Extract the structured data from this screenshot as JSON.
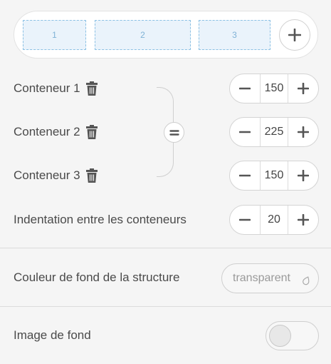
{
  "preview": {
    "cells": [
      "1",
      "2",
      "3"
    ]
  },
  "containers": [
    {
      "label": "Conteneur 1",
      "value": "150"
    },
    {
      "label": "Conteneur 2",
      "value": "225"
    },
    {
      "label": "Conteneur 3",
      "value": "150"
    }
  ],
  "indentation": {
    "label": "Indentation entre les conteneurs",
    "value": "20"
  },
  "background_color": {
    "label": "Couleur de fond de la structure",
    "value": "transparent"
  },
  "background_image": {
    "label": "Image de fond",
    "enabled": false
  },
  "colors": {
    "cell_fill": "#eaf3fb",
    "cell_border": "#8cc1e4",
    "text": "#4a4a4a",
    "icon": "#555555"
  },
  "icons": {
    "add": "plus-icon",
    "delete": "trash-icon",
    "equalize": "equal-icon",
    "decrement": "minus-icon",
    "increment": "plus-icon",
    "color_picker": "droplet-icon"
  }
}
